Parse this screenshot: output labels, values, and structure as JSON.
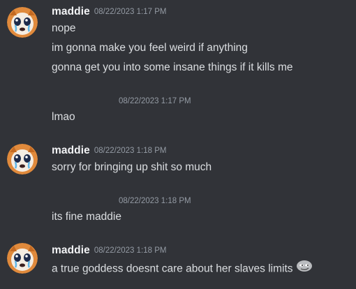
{
  "messages": [
    {
      "author": "maddie",
      "timestamp": "08/22/2023 1:17 PM",
      "lines": [
        "nope",
        "im gonna make you feel weird if anything",
        "gonna get you into some insane things if it kills me"
      ]
    },
    {
      "timestamp": "08/22/2023 1:17 PM",
      "text": "lmao"
    },
    {
      "author": "maddie",
      "timestamp": "08/22/2023 1:18 PM",
      "text": "sorry for bringing up shit so much"
    },
    {
      "timestamp": "08/22/2023 1:18 PM",
      "text": "its fine maddie"
    },
    {
      "author": "maddie",
      "timestamp": "08/22/2023 1:18 PM",
      "text": "a true goddess doesnt care about her slaves limits",
      "emoji": "smirk-emoji"
    }
  ],
  "colors": {
    "background": "#313338",
    "username": "#f2f3f5",
    "message_text": "#dbdee1",
    "timestamp": "#949ba4"
  }
}
